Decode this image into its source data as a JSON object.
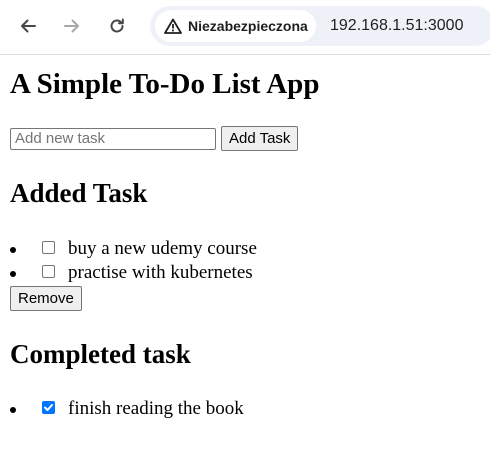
{
  "browser": {
    "security_label": "Niezabezpieczona",
    "url": "192.168.1.51:3000",
    "icons": [
      "back-arrow-icon",
      "forward-arrow-icon",
      "reload-icon",
      "warning-icon"
    ]
  },
  "app": {
    "title": "A Simple To-Do List App",
    "input_placeholder": "Add new task",
    "input_value": "",
    "add_button_label": "Add Task",
    "added_heading": "Added Task",
    "added_tasks": [
      {
        "label": "buy a new udemy course",
        "checked": false
      },
      {
        "label": "practise with kubernetes",
        "checked": false
      }
    ],
    "remove_button_label": "Remove",
    "completed_heading": "Completed task",
    "completed_tasks": [
      {
        "label": "finish reading the book",
        "checked": true
      }
    ]
  },
  "colors": {
    "checkbox_checked": "#0075ff",
    "omnibox_bg": "#eef2f8"
  }
}
